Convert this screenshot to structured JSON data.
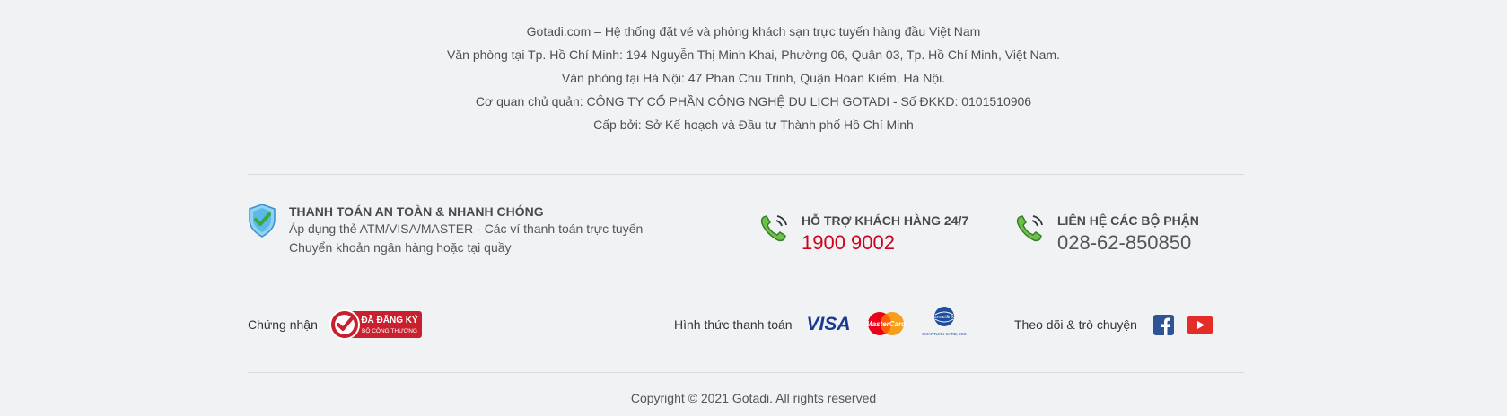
{
  "company": {
    "line1": "Gotadi.com – Hệ thống đặt vé và phòng khách sạn trực tuyến hàng đầu Việt Nam",
    "line2": "Văn phòng tại Tp. Hồ Chí Minh: 194 Nguyễn Thị Minh Khai, Phường 06, Quận 03, Tp. Hồ Chí Minh, Việt Nam.",
    "line3": "Văn phòng tại Hà Nội: 47 Phan Chu Trinh, Quận Hoàn Kiếm, Hà Nội.",
    "line4": "Cơ quan chủ quản: CÔNG TY CỔ PHẦN CÔNG NGHỆ DU LỊCH GOTADI - Số ĐKKD: 0101510906",
    "line5": "Cấp bởi: Sở Kế hoạch và Đầu tư Thành phố Hồ Chí Minh"
  },
  "payment_info": {
    "title": "THANH TOÁN AN TOÀN & NHANH CHÓNG",
    "line1": "Áp dụng thẻ ATM/VISA/MASTER - Các ví thanh toán trực tuyến",
    "line2": "Chuyển khoản ngân hàng hoặc tại quầy",
    "icon": "shield-check-icon"
  },
  "support": {
    "title": "HỖ TRỢ KHÁCH HÀNG 24/7",
    "number": "1900 9002",
    "icon": "phone-icon",
    "number_color": "#d0021b"
  },
  "contact": {
    "title": "LIÊN HỆ CÁC BỘ PHẬN",
    "number": "028-62-850850",
    "icon": "phone-icon"
  },
  "certification": {
    "label": "Chứng nhận",
    "badge_line1": "ĐÃ ĐĂNG KÝ",
    "badge_line2": "BỘ CÔNG THƯƠNG"
  },
  "payment_methods": {
    "label": "Hình thức thanh toán",
    "visa": "VISA",
    "mastercard": "MasterCard",
    "smartlink_top": "smartlink",
    "smartlink_bottom": "SMARTLINK CARD, JSC"
  },
  "social": {
    "label": "Theo dõi & trò chuyện",
    "facebook_icon": "facebook-icon",
    "youtube_icon": "youtube-icon"
  },
  "footer": {
    "copyright": "Copyright © 2021 Gotadi. All rights reserved"
  },
  "colors": {
    "background": "#f0f2f4",
    "accent_red": "#d0021b",
    "phone_green": "#4caf50"
  }
}
